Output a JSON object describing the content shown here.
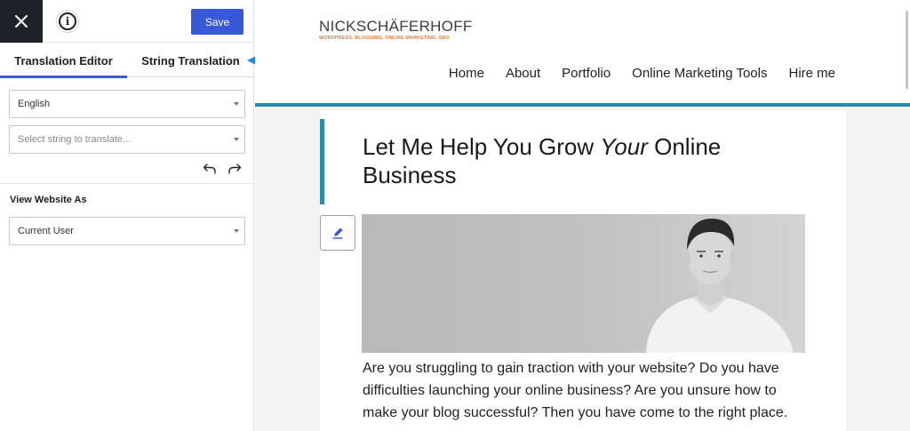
{
  "editor": {
    "save_label": "Save",
    "tabs": [
      {
        "label": "Translation Editor",
        "active": true
      },
      {
        "label": "String Translation",
        "active": false
      }
    ],
    "language_select": {
      "value": "English"
    },
    "string_select": {
      "placeholder": "Select string to translate..."
    },
    "view_as": {
      "title": "View Website As",
      "value": "Current User"
    }
  },
  "site": {
    "logo_name": "NICKSCHÄFERHOFF",
    "logo_tagline": "WORDPRESS, BLOGGING, ONLINE MARKETING, SEO",
    "nav": [
      "Home",
      "About",
      "Portfolio",
      "Online Marketing Tools",
      "Hire me"
    ],
    "heading_before": "Let Me Help You Grow ",
    "heading_em": "Your",
    "heading_after": " Online Business",
    "intro": "Are you struggling to gain traction with your website? Do you have difficulties launching your online business? Are you unsure how to make your blog successful? Then you have come to the right place."
  },
  "colors": {
    "accent_blue": "#3958d8",
    "site_teal": "#2a8cab",
    "logo_orange": "#e27d3f",
    "dark": "#1d2327"
  },
  "icons": [
    "close-icon",
    "info-icon",
    "undo-icon",
    "redo-icon",
    "pencil-icon",
    "arrow-annotation"
  ]
}
